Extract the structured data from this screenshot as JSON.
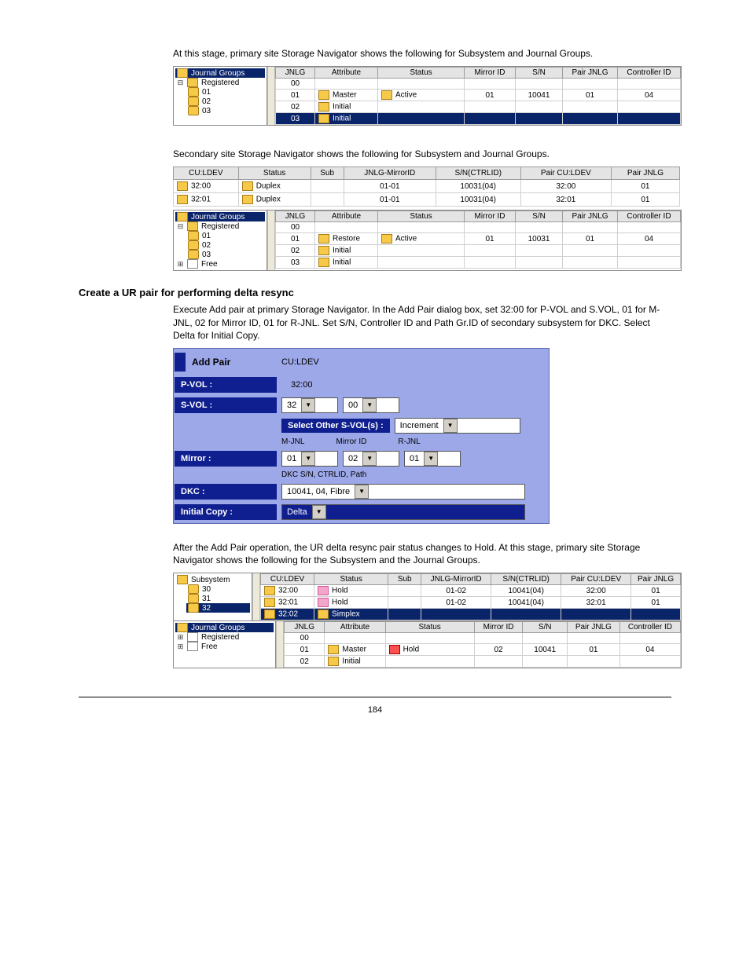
{
  "intro_text_1": "At this stage, primary site Storage Navigator shows the following for Subsystem and Journal Groups.",
  "intro_text_2": "Secondary site Storage Navigator shows the following for Subsystem and Journal Groups.",
  "step2_heading": "Create a UR pair for performing delta resync",
  "step2_text": "Execute Add pair at primary Storage Navigator. In the Add Pair dialog box, set 32:00 for P-VOL and S.VOL, 01 for M-JNL, 02 for Mirror ID, 01 for R-JNL. Set S/N, Controller ID and Path Gr.ID of secondary subsystem for DKC. Select Delta for Initial Copy.",
  "after_addpair_text": "After the Add Pair operation, the UR delta resync pair status changes to Hold. At this stage, primary site Storage Navigator shows the following for the Subsystem and the Journal Groups.",
  "tree1": {
    "root": "Journal Groups",
    "group": "Registered",
    "items": [
      "01",
      "02",
      "03"
    ]
  },
  "grid1": {
    "headers": [
      "JNLG",
      "Attribute",
      "Status",
      "Mirror ID",
      "S/N",
      "Pair JNLG",
      "Controller ID"
    ],
    "rows": [
      {
        "jnlg": "00",
        "attr": "",
        "status": "",
        "mid": "",
        "sn": "",
        "pj": "",
        "cid": "",
        "sel": false
      },
      {
        "jnlg": "01",
        "attr": "Master",
        "status": "Active",
        "mid": "01",
        "sn": "10041",
        "pj": "01",
        "cid": "04",
        "sel": false,
        "attrIcon": true,
        "statIcon": true
      },
      {
        "jnlg": "02",
        "attr": "Initial",
        "status": "",
        "mid": "",
        "sn": "",
        "pj": "",
        "cid": "",
        "sel": false,
        "attrIcon": true
      },
      {
        "jnlg": "03",
        "attr": "Initial",
        "status": "",
        "mid": "",
        "sn": "",
        "pj": "",
        "cid": "",
        "sel": true,
        "attrIcon": true
      }
    ]
  },
  "pairtable1": {
    "headers": [
      "CU:LDEV",
      "Status",
      "Sub",
      "JNLG-MirrorID",
      "S/N(CTRLID)",
      "Pair CU:LDEV",
      "Pair JNLG"
    ],
    "rows": [
      {
        "c": "32:00",
        "s": "Duplex",
        "sub": "",
        "jm": "01-01",
        "sn": "10031(04)",
        "pc": "32:00",
        "pj": "01"
      },
      {
        "c": "32:01",
        "s": "Duplex",
        "sub": "",
        "jm": "01-01",
        "sn": "10031(04)",
        "pc": "32:01",
        "pj": "01"
      }
    ]
  },
  "tree2": {
    "root": "Journal Groups",
    "group": "Registered",
    "items": [
      "01",
      "02",
      "03"
    ],
    "extra": "Free"
  },
  "grid2": {
    "headers": [
      "JNLG",
      "Attribute",
      "Status",
      "Mirror ID",
      "S/N",
      "Pair JNLG",
      "Controller ID"
    ],
    "rows": [
      {
        "jnlg": "00"
      },
      {
        "jnlg": "01",
        "attr": "Restore",
        "status": "Active",
        "mid": "01",
        "sn": "10031",
        "pj": "01",
        "cid": "04",
        "attrIcon": true,
        "statIcon": true
      },
      {
        "jnlg": "02",
        "attr": "Initial",
        "attrIcon": true
      },
      {
        "jnlg": "03",
        "attr": "Initial",
        "attrIcon": true
      }
    ]
  },
  "addpair": {
    "title": "Add Pair",
    "culdev_label": "CU:LDEV",
    "pvol_label": "P-VOL :",
    "pvol_value": "32:00",
    "svol_label": "S-VOL :",
    "svol_values": [
      "32",
      "00"
    ],
    "select_other_label": "Select Other S-VOL(s) :",
    "select_other_value": "Increment",
    "mirror_label": "Mirror :",
    "mjnl_label": "M-JNL",
    "mirrorid_label": "Mirror ID",
    "rjnl_label": "R-JNL",
    "mirror_values": [
      "01",
      "02",
      "01"
    ],
    "dkc_label": "DKC :",
    "dkc_hint": "DKC S/N, CTRLID, Path",
    "dkc_value": "10041, 04, Fibre",
    "initial_label": "Initial Copy :",
    "initial_value": "Delta"
  },
  "tree3a": {
    "root": "Subsystem",
    "items": [
      "30",
      "31",
      "32"
    ]
  },
  "grid3a": {
    "headers": [
      "CU:LDEV",
      "Status",
      "Sub",
      "JNLG-MirrorID",
      "S/N(CTRLID)",
      "Pair CU:LDEV",
      "Pair JNLG"
    ],
    "rows": [
      {
        "c": "32:00",
        "s": "Hold",
        "sub": "",
        "jm": "01-02",
        "sn": "10041(04)",
        "pc": "32:00",
        "pj": "01",
        "icon": "pink"
      },
      {
        "c": "32:01",
        "s": "Hold",
        "sub": "",
        "jm": "01-02",
        "sn": "10041(04)",
        "pc": "32:01",
        "pj": "01",
        "icon": "pink"
      },
      {
        "c": "32:02",
        "s": "Simplex",
        "sub": "",
        "jm": "",
        "sn": "",
        "pc": "",
        "pj": "",
        "sel": true
      }
    ]
  },
  "tree3b": {
    "root": "Journal Groups",
    "items": [
      "Registered",
      "Free"
    ]
  },
  "grid3b": {
    "headers": [
      "JNLG",
      "Attribute",
      "Status",
      "Mirror ID",
      "S/N",
      "Pair JNLG",
      "Controller ID"
    ],
    "rows": [
      {
        "jnlg": "00"
      },
      {
        "jnlg": "01",
        "attr": "Master",
        "status": "Hold",
        "mid": "02",
        "sn": "10041",
        "pj": "01",
        "cid": "04",
        "attrIcon": true,
        "statIcon": "red"
      },
      {
        "jnlg": "02",
        "attr": "Initial",
        "attrIcon": true
      }
    ]
  },
  "page_num": "184"
}
